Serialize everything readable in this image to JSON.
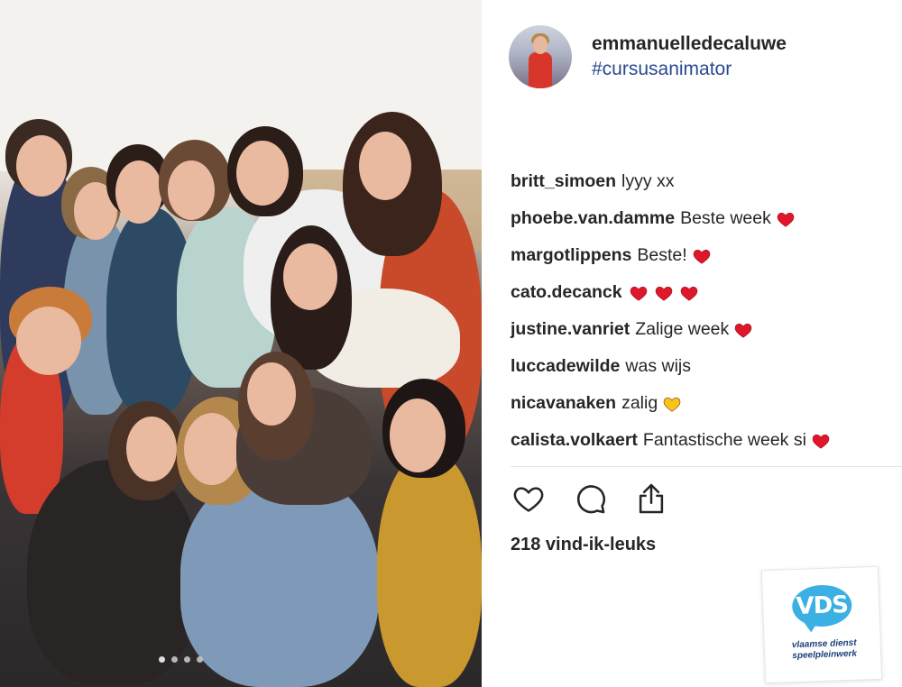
{
  "post": {
    "author_username": "emmanuelledecaluwe",
    "caption_hashtag": "#cursusanimator",
    "carousel_dots": 4,
    "carousel_active_index": 0
  },
  "comments": [
    {
      "user": "britt_simoen",
      "text": "lyyy xx",
      "hearts": 0,
      "heart_color": ""
    },
    {
      "user": "phoebe.van.damme",
      "text": "Beste week",
      "hearts": 1,
      "heart_color": "#e0162b"
    },
    {
      "user": "margotlippens",
      "text": "Beste!",
      "hearts": 1,
      "heart_color": "#e0162b"
    },
    {
      "user": "cato.decanck",
      "text": "",
      "hearts": 3,
      "heart_color": "#e0162b"
    },
    {
      "user": "justine.vanriet",
      "text": "Zalige week",
      "hearts": 1,
      "heart_color": "#e0162b"
    },
    {
      "user": "luccadewilde",
      "text": "was wijs",
      "hearts": 0,
      "heart_color": ""
    },
    {
      "user": "nicavanaken",
      "text": "zalig",
      "hearts": 1,
      "heart_color": "#f5c518"
    },
    {
      "user": "calista.volkaert",
      "text": "Fantastische week si",
      "hearts": 1,
      "heart_color": "#e0162b"
    }
  ],
  "actions": {
    "like_icon": "heart-outline-icon",
    "comment_icon": "speech-bubble-icon",
    "share_icon": "share-upload-icon"
  },
  "likes_text": "218 vind-ik-leuks",
  "logo": {
    "brand_text": "VDS",
    "tagline": "vlaamse dienst speelpleinwerk",
    "brand_color": "#3ab0e3"
  }
}
